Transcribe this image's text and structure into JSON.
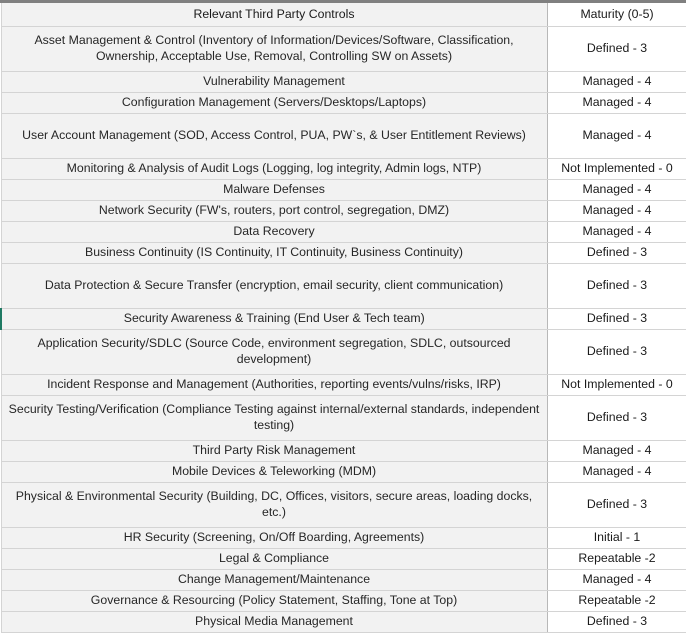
{
  "table": {
    "headers": {
      "control": "Relevant Third Party Controls",
      "maturity": "Maturity (0-5)"
    },
    "accent_color": "#1f7a63",
    "header_bg": "#f2f2f2",
    "control_cell_bg": "#f2f2f2",
    "maturity_cell_bg": "#ffffff",
    "border_color": "#b8b8b8",
    "rows": [
      {
        "control": "Asset Management & Control (Inventory of Information/Devices/Software, Classification, Ownership, Acceptable Use, Removal, Controlling SW on Assets)",
        "maturity": "Defined - 3",
        "lines": 2,
        "accent": false
      },
      {
        "control": "Vulnerability Management",
        "maturity": "Managed - 4",
        "lines": 1,
        "accent": false
      },
      {
        "control": "Configuration Management (Servers/Desktops/Laptops)",
        "maturity": "Managed - 4",
        "lines": 1,
        "accent": false
      },
      {
        "control": "User Account Management (SOD, Access Control, PUA, PW`s, & User Entitlement Reviews)",
        "maturity": "Managed - 4",
        "lines": 2,
        "accent": false
      },
      {
        "control": "Monitoring & Analysis of Audit Logs (Logging, log integrity, Admin logs, NTP)",
        "maturity": "Not Implemented - 0",
        "lines": 1,
        "accent": false
      },
      {
        "control": "Malware Defenses",
        "maturity": "Managed - 4",
        "lines": 1,
        "accent": false
      },
      {
        "control": "Network Security (FW's, routers, port control, segregation, DMZ)",
        "maturity": "Managed - 4",
        "lines": 1,
        "accent": false
      },
      {
        "control": "Data Recovery",
        "maturity": "Managed - 4",
        "lines": 1,
        "accent": false
      },
      {
        "control": "Business Continuity (IS Continuity, IT Continuity, Business Continuity)",
        "maturity": "Defined - 3",
        "lines": 1,
        "accent": false
      },
      {
        "control": "Data Protection & Secure Transfer (encryption, email security, client communication)",
        "maturity": "Defined - 3",
        "lines": 2,
        "accent": false
      },
      {
        "control": "Security Awareness & Training (End User & Tech team)",
        "maturity": "Defined - 3",
        "lines": 1,
        "accent": true
      },
      {
        "control": "Application Security/SDLC (Source Code, environment segregation, SDLC, outsourced development)",
        "maturity": "Defined - 3",
        "lines": 2,
        "accent": false
      },
      {
        "control": "Incident Response and Management (Authorities, reporting events/vulns/risks, IRP)",
        "maturity": "Not Implemented - 0",
        "lines": 1,
        "accent": false
      },
      {
        "control": "Security Testing/Verification (Compliance Testing against internal/external standards, independent testing)",
        "maturity": "Defined - 3",
        "lines": 2,
        "accent": false
      },
      {
        "control": "Third Party Risk Management",
        "maturity": "Managed - 4",
        "lines": 1,
        "accent": false
      },
      {
        "control": "Mobile Devices & Teleworking (MDM)",
        "maturity": "Managed - 4",
        "lines": 1,
        "accent": false
      },
      {
        "control": "Physical & Environmental Security (Building, DC, Offices, visitors, secure areas, loading docks, etc.)",
        "maturity": "Defined - 3",
        "lines": 2,
        "accent": false
      },
      {
        "control": "HR Security (Screening, On/Off Boarding, Agreements)",
        "maturity": "Initial - 1",
        "lines": 1,
        "accent": false
      },
      {
        "control": "Legal & Compliance",
        "maturity": "Repeatable -2",
        "lines": 1,
        "accent": false
      },
      {
        "control": "Change Management/Maintenance",
        "maturity": "Managed - 4",
        "lines": 1,
        "accent": false
      },
      {
        "control": "Governance & Resourcing (Policy Statement, Staffing, Tone at Top)",
        "maturity": "Repeatable -2",
        "lines": 1,
        "accent": false
      },
      {
        "control": "Physical Media Management",
        "maturity": "Defined - 3",
        "lines": 1,
        "accent": false
      }
    ]
  }
}
